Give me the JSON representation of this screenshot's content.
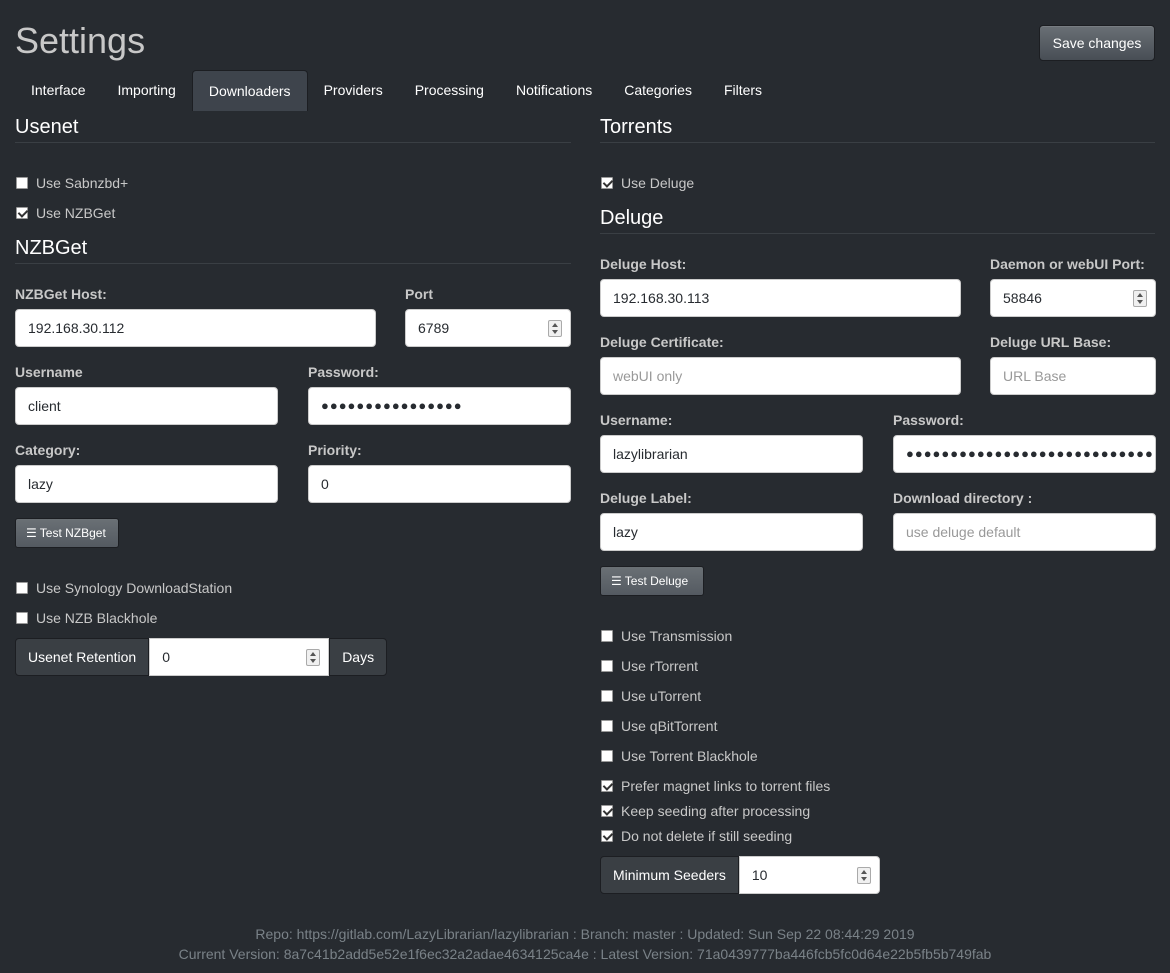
{
  "header": {
    "title": "Settings",
    "save_label": "Save changes"
  },
  "tabs": [
    "Interface",
    "Importing",
    "Downloaders",
    "Providers",
    "Processing",
    "Notifications",
    "Categories",
    "Filters"
  ],
  "usenet": {
    "heading": "Usenet",
    "use_sab": "Use Sabnzbd+",
    "use_nzbget": "Use NZBGet",
    "nzbget_heading": "NZBGet",
    "host_label": "NZBGet Host:",
    "host_value": "192.168.30.112",
    "port_label": "Port",
    "port_value": "6789",
    "user_label": "Username",
    "user_value": "client",
    "pass_label": "Password:",
    "pass_value": "●●●●●●●●●●●●●●●●",
    "cat_label": "Category:",
    "cat_value": "lazy",
    "prio_label": "Priority:",
    "prio_value": "0",
    "test_label": "Test NZBget",
    "use_synology": "Use Synology DownloadStation",
    "use_blackhole": "Use NZB Blackhole",
    "retention_label": "Usenet Retention",
    "retention_value": "0",
    "retention_unit": "Days"
  },
  "torrents": {
    "heading": "Torrents",
    "use_deluge": "Use Deluge",
    "deluge_heading": "Deluge",
    "host_label": "Deluge Host:",
    "host_value": "192.168.30.113",
    "port_label": "Daemon or webUI Port:",
    "port_value": "58846",
    "cert_label": "Deluge Certificate:",
    "cert_placeholder": "webUI only",
    "urlbase_label": "Deluge URL Base:",
    "urlbase_placeholder": "URL Base",
    "user_label": "Username:",
    "user_value": "lazylibrarian",
    "pass_label": "Password:",
    "pass_value": "●●●●●●●●●●●●●●●●●●●●●●●●●●●●●●",
    "dlabel_label": "Deluge Label:",
    "dlabel_value": "lazy",
    "dir_label": "Download directory :",
    "dir_placeholder": "use deluge default",
    "test_label": "Test Deluge",
    "use_transmission": "Use Transmission",
    "use_rtorrent": "Use rTorrent",
    "use_utorrent": "Use uTorrent",
    "use_qbit": "Use qBitTorrent",
    "use_blackhole": "Use Torrent Blackhole",
    "prefer_magnet": "Prefer magnet links to torrent files",
    "keep_seeding": "Keep seeding after processing",
    "no_delete": "Do not delete if still seeding",
    "seeders_label": "Minimum Seeders",
    "seeders_value": "10"
  },
  "footer": {
    "line1": "Repo: https://gitlab.com/LazyLibrarian/lazylibrarian : Branch: master : Updated: Sun Sep 22 08:44:29 2019",
    "line2": "Current Version: 8a7c41b2add5e52e1f6ec32a2adae4634125ca4e : Latest Version: 71a0439777ba446fcb5fc0d64e22b5fb5b749fab"
  }
}
